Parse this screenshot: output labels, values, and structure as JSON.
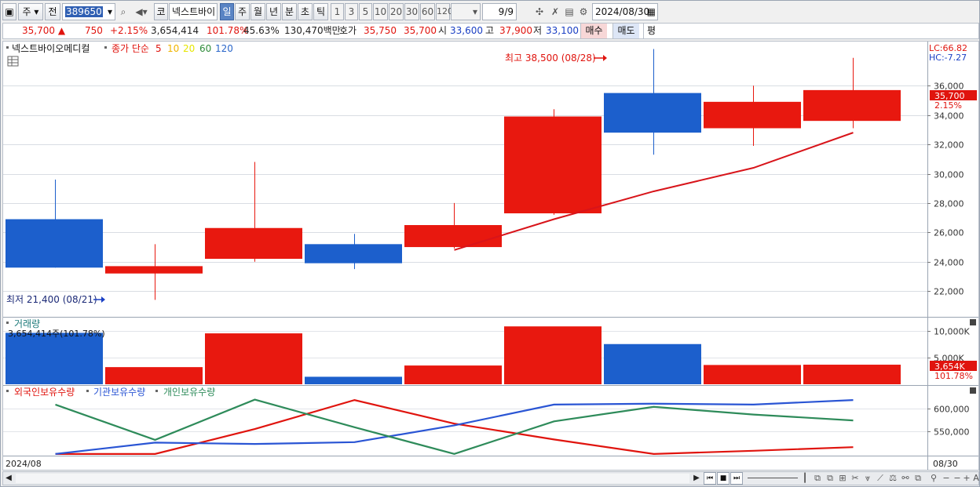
{
  "toolbar": {
    "market_label": "주",
    "all_label": "전",
    "code": "389650",
    "icon_ko": "코",
    "stock_name": "넥스트바이",
    "periods": [
      "일",
      "주",
      "월",
      "년",
      "분",
      "초",
      "틱"
    ],
    "active_period": "일",
    "intervals": [
      "1",
      "3",
      "5",
      "10",
      "20",
      "30",
      "60",
      "120"
    ],
    "count": "9",
    "count_sep": "/9",
    "date": "2024/08/30"
  },
  "quote": {
    "price": "35,700",
    "up_mark": "▲",
    "change": "750",
    "change_pct": "+2.15%",
    "volume": "3,654,414",
    "vol_ratio": "101.78%",
    "turnover": "45.63%",
    "amount": "130,470백만",
    "hoga_label": "호가",
    "hoga1": "35,750",
    "hoga2": "35,700",
    "open_label": "시",
    "open": "33,600",
    "high_label": "고",
    "high": "37,900",
    "low_label": "저",
    "low": "33,100",
    "buy_label": "매수",
    "sell_label": "매도",
    "eq_label": "평"
  },
  "legend": {
    "name": "넥스트바이오메디컬",
    "ma_title": "종가 단순",
    "ma_periods": [
      "5",
      "10",
      "20",
      "60",
      "120"
    ],
    "ma_colors": [
      "#e0140e",
      "#f0b400",
      "#e6e600",
      "#2e8b3a",
      "#2a66c9"
    ]
  },
  "annotations": {
    "high_note": "최고 38,500 (08/28)",
    "low_note": "최저 21,400 (08/21)"
  },
  "right_axis": {
    "lc": "LC:66.82",
    "hc": "HC:-7.27",
    "price_tag": "35,700",
    "pct_tag": "2.15%",
    "vol_tag": "3,654K",
    "vol_pct_tag": "101.78%",
    "bottom_date": "08/30"
  },
  "volume_panel": {
    "title": "거래량",
    "info": "3,654,414주(101.78%)"
  },
  "holdings_panel": {
    "labels": [
      "외국인보유수량",
      "기관보유수량",
      "개인보유수량"
    ],
    "colors": [
      "#e0140e",
      "#2a55d4",
      "#2e8b5a"
    ]
  },
  "footer": {
    "left_date": "2024/08"
  },
  "chart_data": [
    {
      "type": "candlestick",
      "title": "넥스트바이오메디컬",
      "y_ticks": [
        22000,
        24000,
        26000,
        28000,
        30000,
        32000,
        34000,
        36000
      ],
      "ylim": [
        20300,
        38900
      ],
      "grid": true,
      "candles": [
        {
          "open": 26900,
          "high": 29600,
          "low": 23600,
          "close": 23600,
          "color": "blue"
        },
        {
          "open": 23200,
          "high": 25200,
          "low": 21400,
          "close": 23700,
          "color": "red"
        },
        {
          "open": 24200,
          "high": 30800,
          "low": 24000,
          "close": 26300,
          "color": "red"
        },
        {
          "open": 25200,
          "high": 25900,
          "low": 23500,
          "close": 23900,
          "color": "blue"
        },
        {
          "open": 25000,
          "high": 28000,
          "low": 24900,
          "close": 26500,
          "color": "red"
        },
        {
          "open": 27300,
          "high": 34400,
          "low": 27200,
          "close": 33900,
          "color": "red"
        },
        {
          "open": 35500,
          "high": 38500,
          "low": 31300,
          "close": 32800,
          "color": "blue"
        },
        {
          "open": 33100,
          "high": 36000,
          "low": 31900,
          "close": 34900,
          "color": "red"
        },
        {
          "open": 33600,
          "high": 37900,
          "low": 33100,
          "close": 35700,
          "color": "red"
        }
      ],
      "ma5": [
        null,
        null,
        null,
        null,
        24800,
        26900,
        28800,
        30400,
        32800
      ]
    },
    {
      "type": "bar",
      "title": "거래량",
      "y_ticks": [
        5000,
        10000
      ],
      "y_tick_labels": [
        "5,000K",
        "10,000K"
      ],
      "ylim": [
        0,
        12000
      ],
      "values": [
        9600,
        3200,
        9500,
        1400,
        3500,
        10800,
        7500,
        3600,
        3654
      ],
      "colors": [
        "blue",
        "red",
        "red",
        "blue",
        "red",
        "red",
        "blue",
        "red",
        "red"
      ]
    },
    {
      "type": "line",
      "title": "",
      "y_ticks": [
        550000,
        600000
      ],
      "y_tick_labels": [
        "550,000",
        "600,000"
      ],
      "ylim": [
        498000,
        640000
      ],
      "series": [
        {
          "name": "외국인보유수량",
          "color": "#e0140e",
          "values": [
            500000,
            500000,
            555000,
            619000,
            567000,
            532000,
            500000,
            507000,
            515000
          ]
        },
        {
          "name": "기관보유수량",
          "color": "#2a55d4",
          "values": [
            500000,
            525000,
            522000,
            526000,
            563000,
            609000,
            611000,
            609000,
            619000
          ]
        },
        {
          "name": "개인보유수량",
          "color": "#2e8b5a",
          "values": [
            609000,
            531000,
            620000,
            559000,
            500000,
            572000,
            604000,
            587000,
            574000
          ]
        }
      ]
    }
  ]
}
